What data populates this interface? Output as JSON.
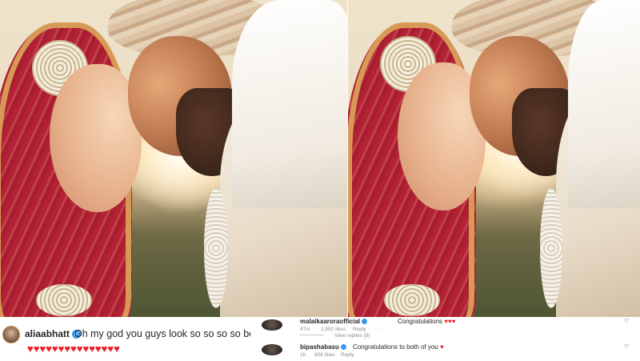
{
  "comment_alia": {
    "username": "aliaabhatt",
    "text": "Oh my god you guys look so so so so beautiful",
    "hearts": "♥♥♥♥♥♥♥♥♥♥♥♥♥♥♥"
  },
  "comments_panel": [
    {
      "username": "malaikaaroraofficial",
      "text": "Congratulations",
      "hearts": "♥♥♥",
      "time": "47m",
      "likes": "1,552 likes",
      "reply": "Reply",
      "view_replies": "View replies (8)"
    },
    {
      "username": "bipashabasu",
      "text": "Congratulations to both of you",
      "hearts": "♥",
      "time": "1h",
      "likes": "806 likes",
      "reply": "Reply"
    }
  ],
  "colors": {
    "heart_red": "#ed1c24",
    "verified_blue": "#3897f0",
    "meta_gray": "#8e8e8e"
  }
}
